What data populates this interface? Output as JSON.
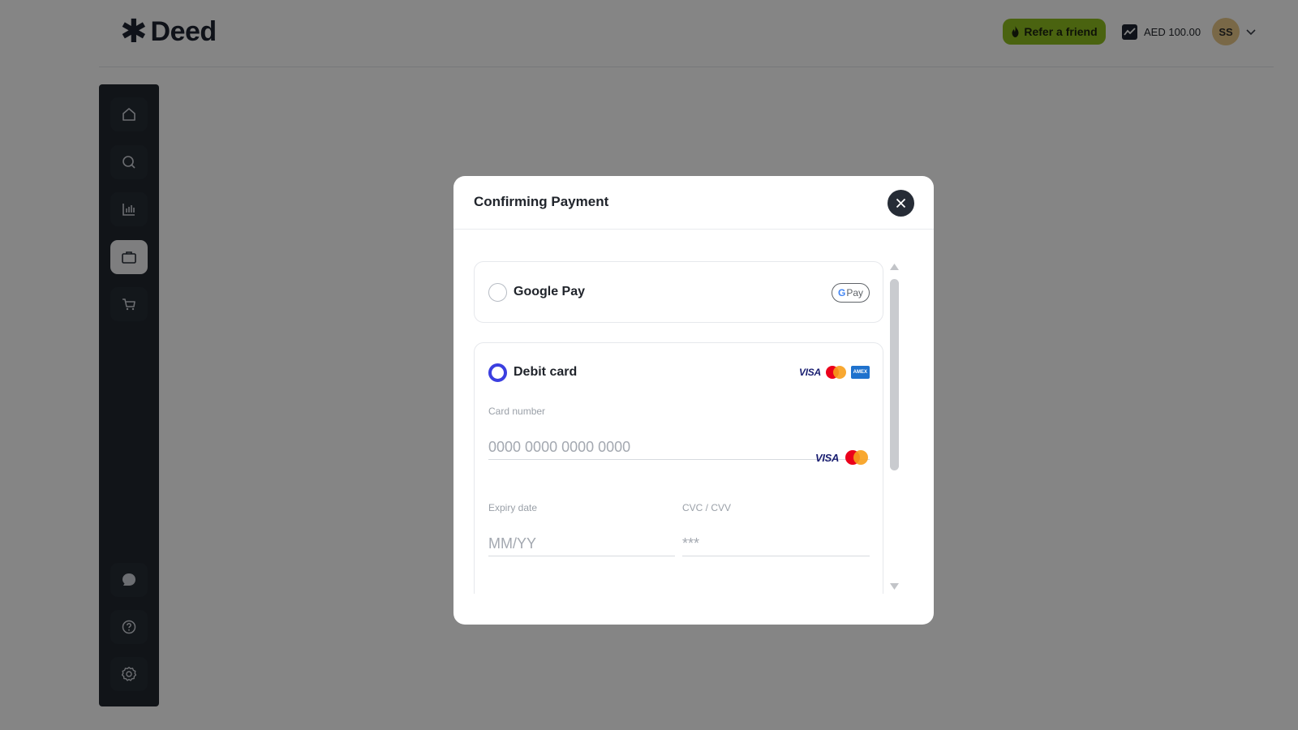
{
  "app": {
    "logo_mark": "✱",
    "logo_text": "Deed"
  },
  "header": {
    "refer_label": "Refer a friend",
    "balance_label": "AED 100.00",
    "avatar_initials": "SS"
  },
  "sidebar": {
    "items": [
      {
        "icon": "home-icon"
      },
      {
        "icon": "search-icon"
      },
      {
        "icon": "chart-icon"
      },
      {
        "icon": "briefcase-icon",
        "active": true
      },
      {
        "icon": "cart-icon"
      }
    ],
    "bottom_items": [
      {
        "icon": "chat-icon"
      },
      {
        "icon": "help-icon"
      },
      {
        "icon": "settings-icon"
      }
    ]
  },
  "modal": {
    "title": "Confirming Payment",
    "google_pay": {
      "label": "Google Pay",
      "badge_g": "G",
      "badge_text": "Pay",
      "selected": false
    },
    "debit_card": {
      "label": "Debit card",
      "selected": true,
      "brand_visa": "VISA",
      "brand_amex": "AMEX",
      "card_number_label": "Card number",
      "card_number_placeholder": "0000 0000 0000 0000",
      "expiry_label": "Expiry date",
      "expiry_placeholder": "MM/YY",
      "cvc_label": "CVC / CVV",
      "cvc_placeholder": "***"
    }
  },
  "colors": {
    "accent_refer": "#8fbf1f",
    "radio_selected": "#3b3fe0",
    "sidebar_bg": "#21272f",
    "overlay": "rgba(0,0,0,0.48)"
  }
}
